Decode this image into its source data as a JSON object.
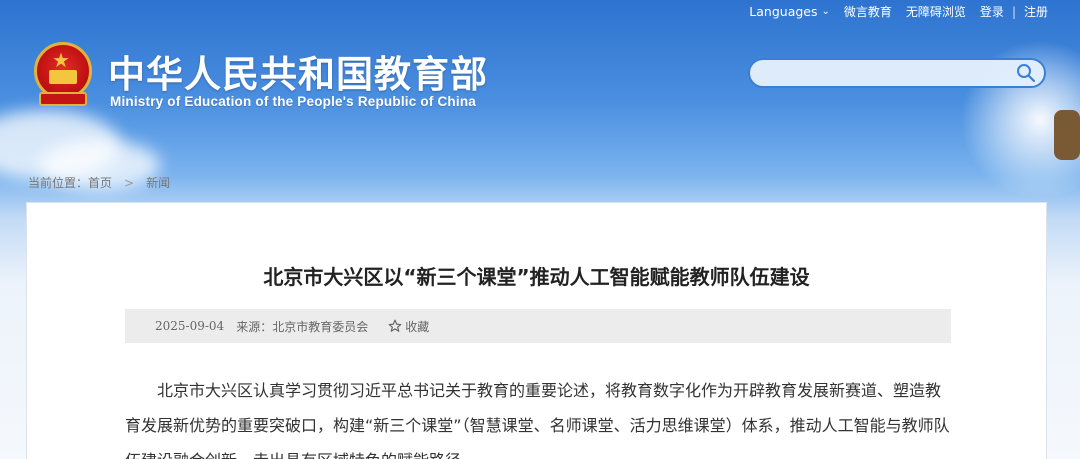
{
  "topnav": {
    "languages": "Languages",
    "links": [
      "微言教育",
      "无障碍浏览",
      "登录",
      "注册"
    ]
  },
  "brand": {
    "name_cn": "中华人民共和国教育部",
    "name_en": "Ministry of Education of the People's Republic of China"
  },
  "search": {
    "placeholder": "",
    "value": ""
  },
  "breadcrumb": {
    "label": "当前位置：",
    "items": [
      "首页",
      "新闻"
    ]
  },
  "article": {
    "title": "北京市大兴区以“新三个课堂”推动人工智能赋能教师队伍建设",
    "date": "2025-09-04",
    "source": "来源：北京市教育委员会",
    "favorite_label": "收藏",
    "paragraph": "北京市大兴区认真学习贯彻习近平总书记关于教育的重要论述，将教育数字化作为开辟教育发展新赛道、塑造教育发展新优势的重要突破口，构建“新三个课堂”（智慧课堂、名师课堂、活力思维课堂）体系，推动人工智能与教师队伍建设融合创新，走出具有区域特色的赋能路径。"
  },
  "colors": {
    "header_blue": "#2e73cf",
    "search_border": "#3a7fd5",
    "meta_bg": "#ececec"
  },
  "icons": {
    "dropdown": "chevron-down-icon",
    "search": "search-icon",
    "favorite": "star-outline-icon",
    "crumb_sep": "chevron-right-icon"
  }
}
